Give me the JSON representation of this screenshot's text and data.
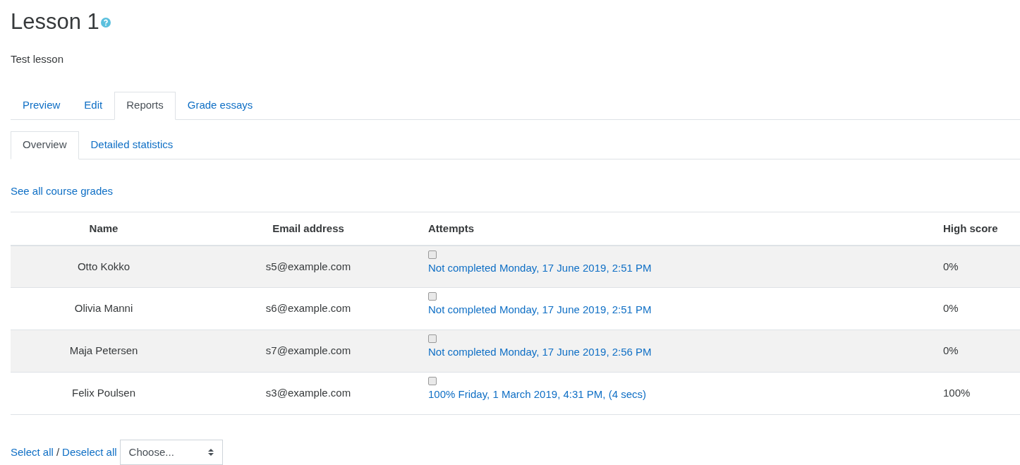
{
  "title": "Lesson 1",
  "description": "Test lesson",
  "tabs": [
    {
      "label": "Preview",
      "selected": false
    },
    {
      "label": "Edit",
      "selected": false
    },
    {
      "label": "Reports",
      "selected": true
    },
    {
      "label": "Grade essays",
      "selected": false
    }
  ],
  "subtabs": [
    {
      "label": "Overview",
      "selected": true
    },
    {
      "label": "Detailed statistics",
      "selected": false
    }
  ],
  "grades_link": "See all course grades",
  "table": {
    "columns": [
      "Name",
      "Email address",
      "Attempts",
      "High score"
    ],
    "rows": [
      {
        "name": "Otto Kokko",
        "email": "s5@example.com",
        "attempt": "Not completed Monday, 17 June 2019, 2:51 PM",
        "checked": false,
        "high_score": "0%"
      },
      {
        "name": "Olivia Manni",
        "email": "s6@example.com",
        "attempt": "Not completed Monday, 17 June 2019, 2:51 PM",
        "checked": false,
        "high_score": "0%"
      },
      {
        "name": "Maja Petersen",
        "email": "s7@example.com",
        "attempt": "Not completed Monday, 17 June 2019, 2:56 PM",
        "checked": false,
        "high_score": "0%"
      },
      {
        "name": "Felix Poulsen",
        "email": "s3@example.com",
        "attempt": "100% Friday, 1 March 2019, 4:31 PM, (4 secs)",
        "checked": false,
        "high_score": "100%"
      }
    ]
  },
  "footer": {
    "select_all": "Select all",
    "separator": "/",
    "deselect_all": "Deselect all",
    "action_select": {
      "value": "Choose..."
    }
  }
}
